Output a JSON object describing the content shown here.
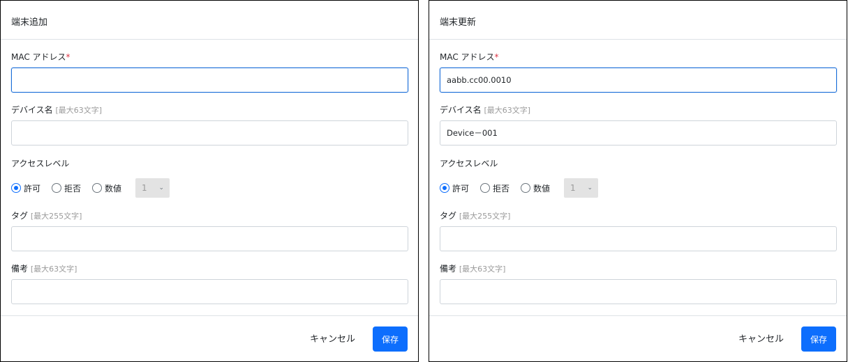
{
  "theme": {
    "accent": "#0d6efd",
    "required": "#dc3545",
    "focus_border": "#1a6ed8"
  },
  "dialogs": [
    {
      "title": "端末追加",
      "mac": {
        "label": "MAC アドレス",
        "required_mark": "*",
        "value": ""
      },
      "name": {
        "label": "デバイス名",
        "hint": "[最大63文字]",
        "value": ""
      },
      "access": {
        "label": "アクセスレベル",
        "options": [
          "許可",
          "拒否",
          "数値"
        ],
        "selected": "許可",
        "number_value": "1"
      },
      "tag": {
        "label": "タグ",
        "hint": "[最大255文字]",
        "value": ""
      },
      "note": {
        "label": "備考",
        "hint": "[最大63文字]",
        "value": ""
      },
      "footer": {
        "cancel": "キャンセル",
        "save": "保存"
      }
    },
    {
      "title": "端末更新",
      "mac": {
        "label": "MAC アドレス",
        "required_mark": "*",
        "value": "aabb.cc00.0010"
      },
      "name": {
        "label": "デバイス名",
        "hint": "[最大63文字]",
        "value": "Device－001"
      },
      "access": {
        "label": "アクセスレベル",
        "options": [
          "許可",
          "拒否",
          "数値"
        ],
        "selected": "許可",
        "number_value": "1"
      },
      "tag": {
        "label": "タグ",
        "hint": "[最大255文字]",
        "value": ""
      },
      "note": {
        "label": "備考",
        "hint": "[最大63文字]",
        "value": ""
      },
      "footer": {
        "cancel": "キャンセル",
        "save": "保存"
      }
    }
  ]
}
